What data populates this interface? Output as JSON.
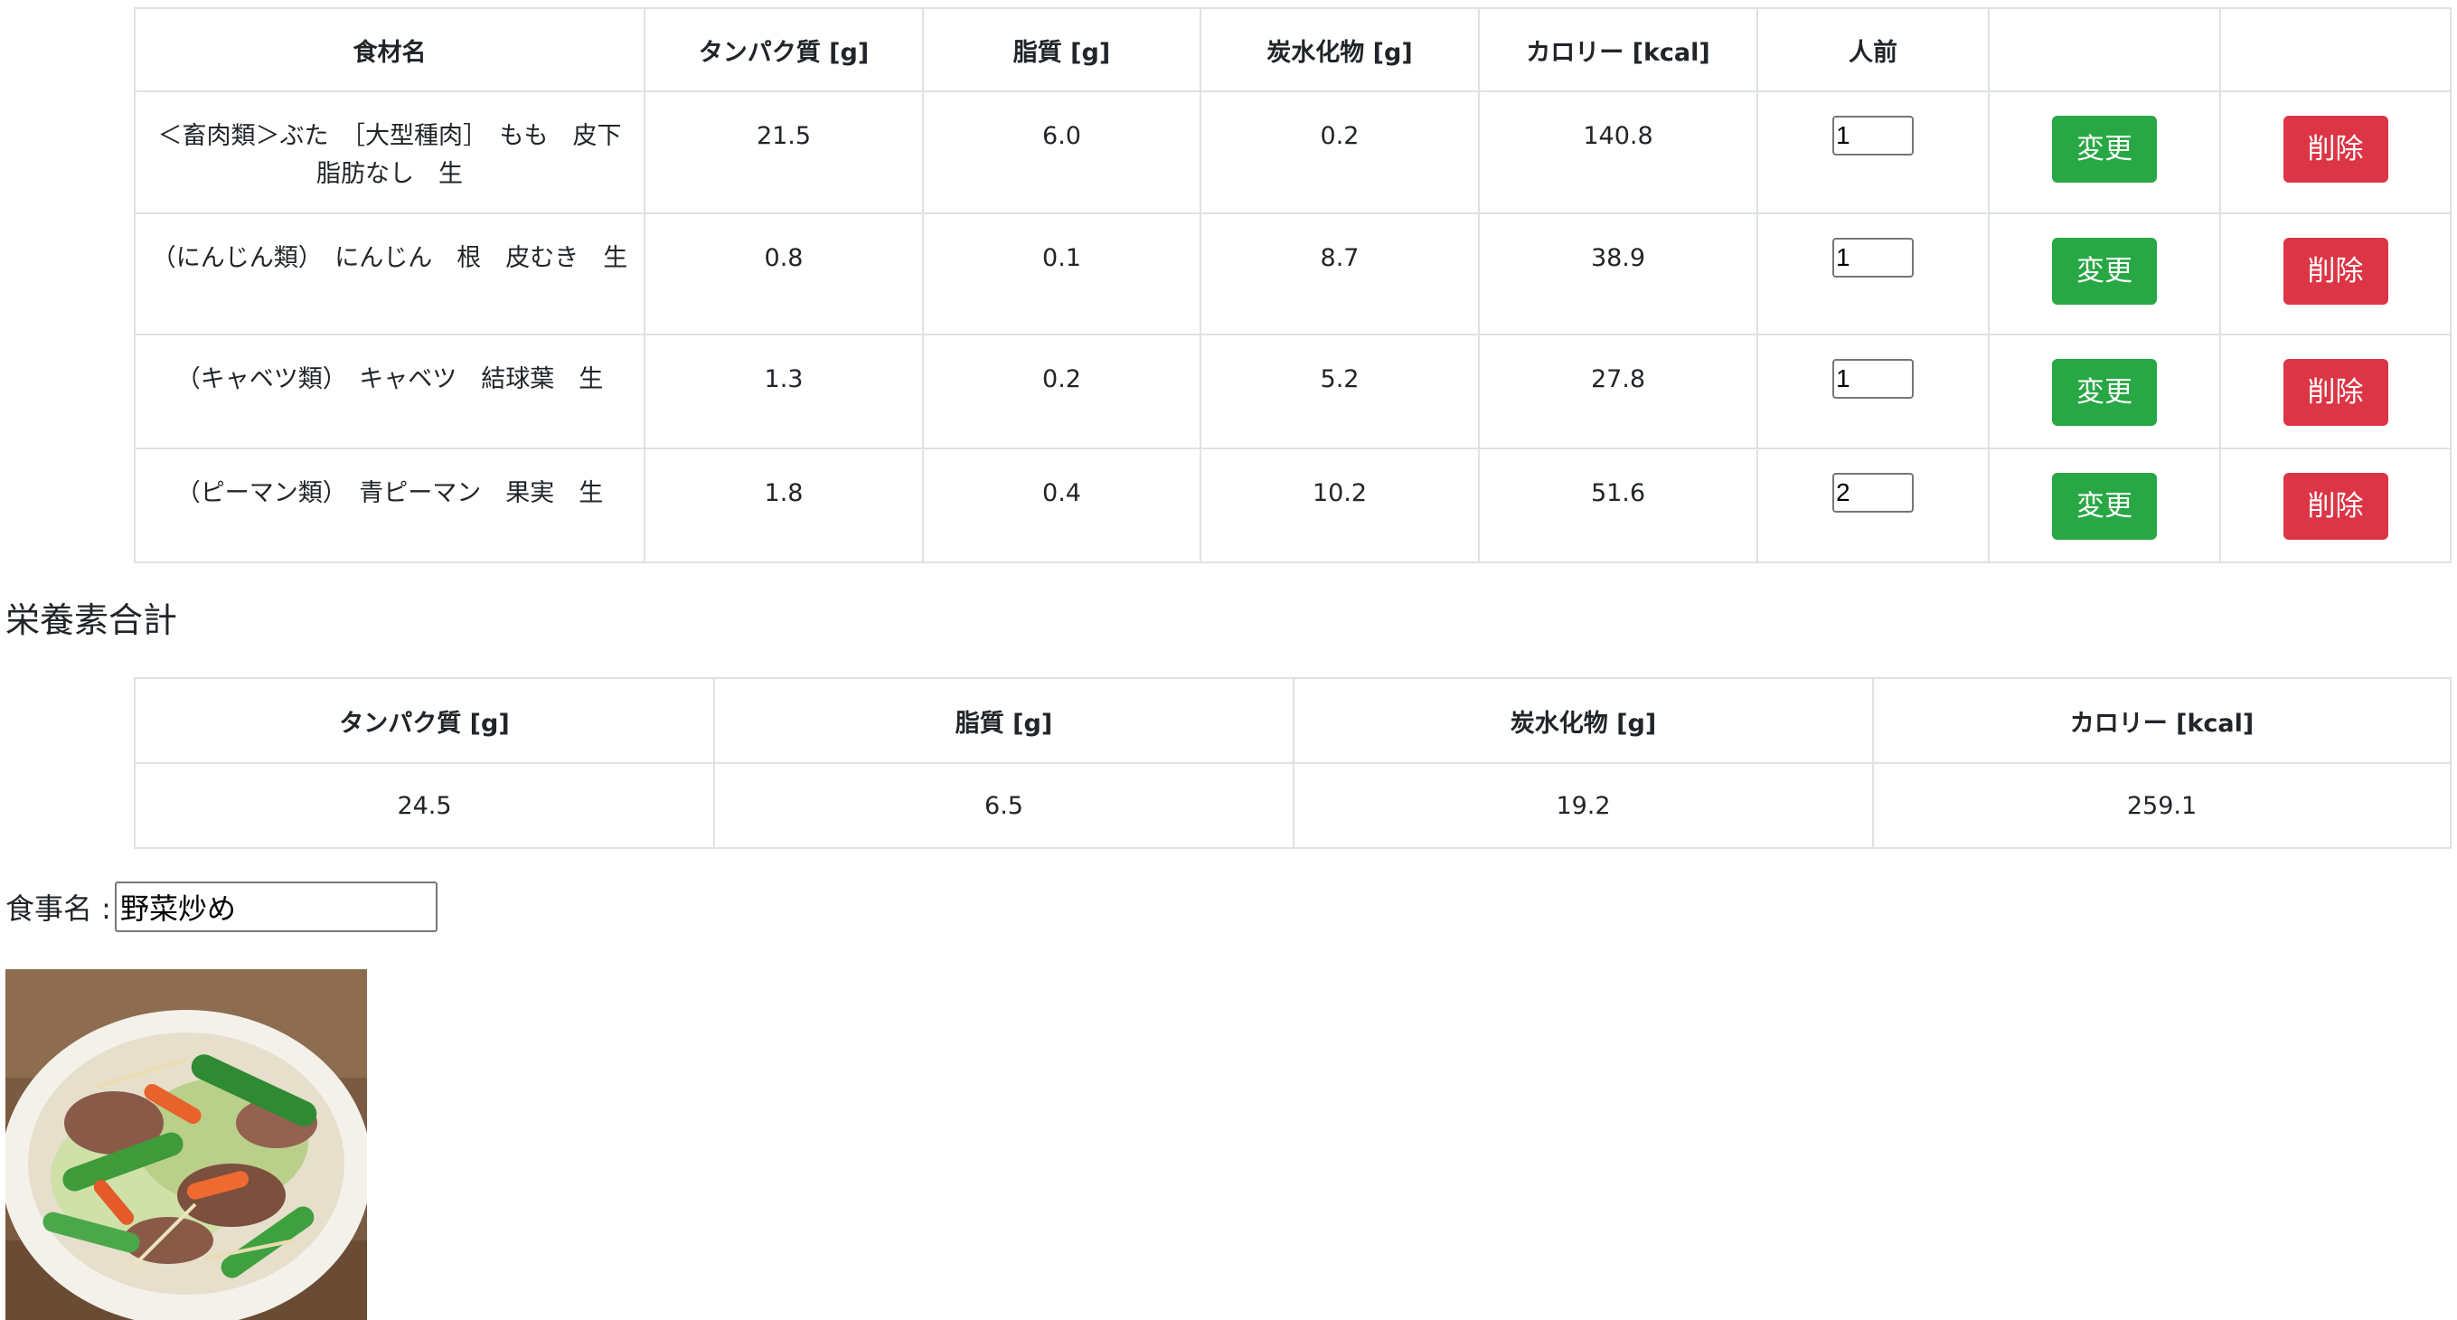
{
  "ingredients_table": {
    "headers": [
      "食材名",
      "タンパク質 [g]",
      "脂質 [g]",
      "炭水化物 [g]",
      "カロリー [kcal]",
      "人前",
      "",
      ""
    ],
    "rows": [
      {
        "name": "＜畜肉類＞ぶた　［大型種肉］　もも　皮下脂肪なし　生",
        "protein": "21.5",
        "fat": "6.0",
        "carbs": "0.2",
        "calories": "140.8",
        "servings": "1",
        "change_label": "変更",
        "delete_label": "削除"
      },
      {
        "name": "（にんじん類）　にんじん　根　皮むき　生",
        "protein": "0.8",
        "fat": "0.1",
        "carbs": "8.7",
        "calories": "38.9",
        "servings": "1",
        "change_label": "変更",
        "delete_label": "削除"
      },
      {
        "name": "（キャベツ類）　キャベツ　結球葉　生",
        "protein": "1.3",
        "fat": "0.2",
        "carbs": "5.2",
        "calories": "27.8",
        "servings": "1",
        "change_label": "変更",
        "delete_label": "削除"
      },
      {
        "name": "（ピーマン類）　青ピーマン　果実　生",
        "protein": "1.8",
        "fat": "0.4",
        "carbs": "10.2",
        "calories": "51.6",
        "servings": "2",
        "change_label": "変更",
        "delete_label": "削除"
      }
    ]
  },
  "totals": {
    "title": "栄養素合計",
    "headers": [
      "タンパク質 [g]",
      "脂質 [g]",
      "炭水化物 [g]",
      "カロリー [kcal]"
    ],
    "values": [
      "24.5",
      "6.5",
      "19.2",
      "259.1"
    ]
  },
  "meal": {
    "label": "食事名 :",
    "value": "野菜炒め"
  },
  "colors": {
    "change_button": "#28a745",
    "delete_button": "#dc3545",
    "border": "#dee2e6"
  }
}
